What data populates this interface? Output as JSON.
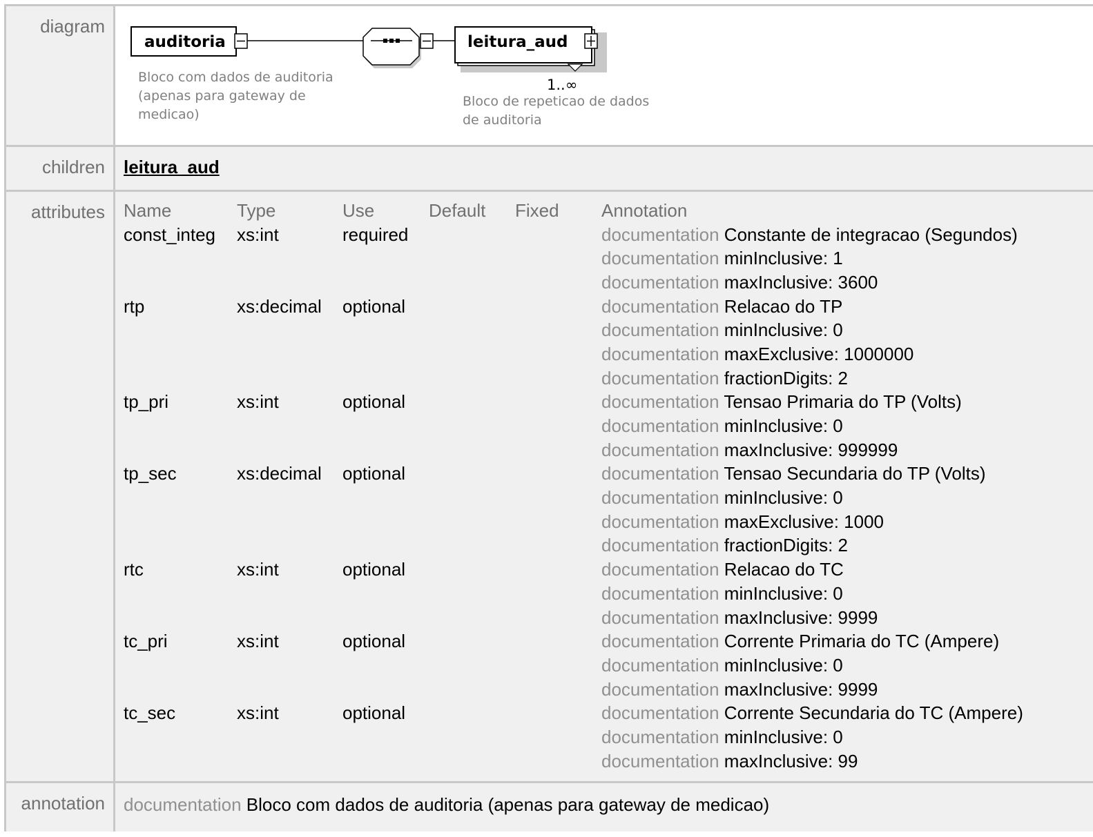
{
  "labels": {
    "diagram": "diagram",
    "children": "children",
    "attributes": "attributes",
    "annotation": "annotation"
  },
  "diagram": {
    "element_name": "auditoria",
    "element_desc": [
      "Bloco com dados de auditoria",
      "(apenas para gateway de",
      "medicao)"
    ],
    "child_name": "leitura_aud",
    "child_multiplicity": "1..∞",
    "child_desc": [
      "Bloco de repeticao de dados",
      "de auditoria"
    ]
  },
  "children": [
    "leitura_aud"
  ],
  "attributes": {
    "headers": [
      "Name",
      "Type",
      "Use",
      "Default",
      "Fixed",
      "Annotation"
    ],
    "doc_keyword": "documentation",
    "rows": [
      {
        "name": "const_integ",
        "type": "xs:int",
        "use": "required",
        "default": "",
        "fixed": "",
        "annotations": [
          "Constante de integracao (Segundos)",
          "minInclusive: 1",
          "maxInclusive: 3600"
        ]
      },
      {
        "name": "rtp",
        "type": "xs:decimal",
        "use": "optional",
        "default": "",
        "fixed": "",
        "annotations": [
          "Relacao do TP",
          "minInclusive: 0",
          "maxExclusive: 1000000",
          "fractionDigits: 2"
        ]
      },
      {
        "name": "tp_pri",
        "type": "xs:int",
        "use": "optional",
        "default": "",
        "fixed": "",
        "annotations": [
          "Tensao Primaria do TP (Volts)",
          "minInclusive: 0",
          "maxInclusive: 999999"
        ]
      },
      {
        "name": "tp_sec",
        "type": "xs:decimal",
        "use": "optional",
        "default": "",
        "fixed": "",
        "annotations": [
          "Tensao Secundaria do TP (Volts)",
          "minInclusive: 0",
          "maxExclusive: 1000",
          "fractionDigits: 2"
        ]
      },
      {
        "name": "rtc",
        "type": "xs:int",
        "use": "optional",
        "default": "",
        "fixed": "",
        "annotations": [
          "Relacao do TC",
          "minInclusive: 0",
          "maxInclusive: 9999"
        ]
      },
      {
        "name": "tc_pri",
        "type": "xs:int",
        "use": "optional",
        "default": "",
        "fixed": "",
        "annotations": [
          "Corrente Primaria do TC (Ampere)",
          "minInclusive: 0",
          "maxInclusive: 9999"
        ]
      },
      {
        "name": "tc_sec",
        "type": "xs:int",
        "use": "optional",
        "default": "",
        "fixed": "",
        "annotations": [
          "Corrente Secundaria do TC (Ampere)",
          "minInclusive: 0",
          "maxInclusive: 99"
        ]
      }
    ]
  },
  "annotation": {
    "keyword": "documentation",
    "text": "Bloco com dados de auditoria (apenas para gateway de medicao)"
  }
}
